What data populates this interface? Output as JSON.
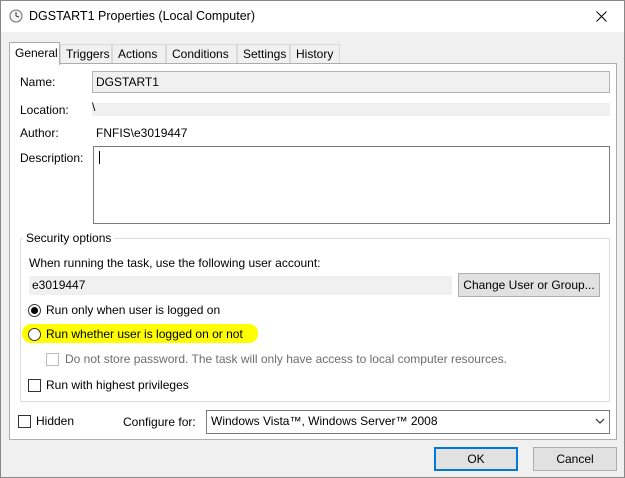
{
  "window": {
    "title": "DGSTART1 Properties (Local Computer)",
    "close_label": "✕"
  },
  "tabs": [
    {
      "label": "General",
      "active": true
    },
    {
      "label": "Triggers"
    },
    {
      "label": "Actions"
    },
    {
      "label": "Conditions"
    },
    {
      "label": "Settings"
    },
    {
      "label": "History"
    }
  ],
  "general": {
    "name_label": "Name:",
    "name_value": "DGSTART1",
    "location_label": "Location:",
    "location_value": "\\",
    "author_label": "Author:",
    "author_value": "FNFIS\\e3019447",
    "description_label": "Description:",
    "description_value": ""
  },
  "security": {
    "title": "Security options",
    "account_prompt": "When running the task, use the following user account:",
    "account_value": "e3019447",
    "change_button": "Change User or Group...",
    "run_logged_on": "Run only when user is logged on",
    "run_logged_on_selected": true,
    "run_whether": "Run whether user is logged on or not",
    "run_whether_selected": false,
    "run_whether_highlight_color": "#ffff00",
    "no_store_password": "Do not store password.  The task will only have access to local computer resources.",
    "highest_privileges": "Run with highest privileges"
  },
  "footer": {
    "hidden_label": "Hidden",
    "configure_label": "Configure for:",
    "configure_value": "Windows Vista™, Windows Server™ 2008",
    "ok_button": "OK",
    "cancel_button": "Cancel"
  },
  "colors": {
    "accent": "#0078d7",
    "dialog_bg": "#f0f0f0"
  }
}
